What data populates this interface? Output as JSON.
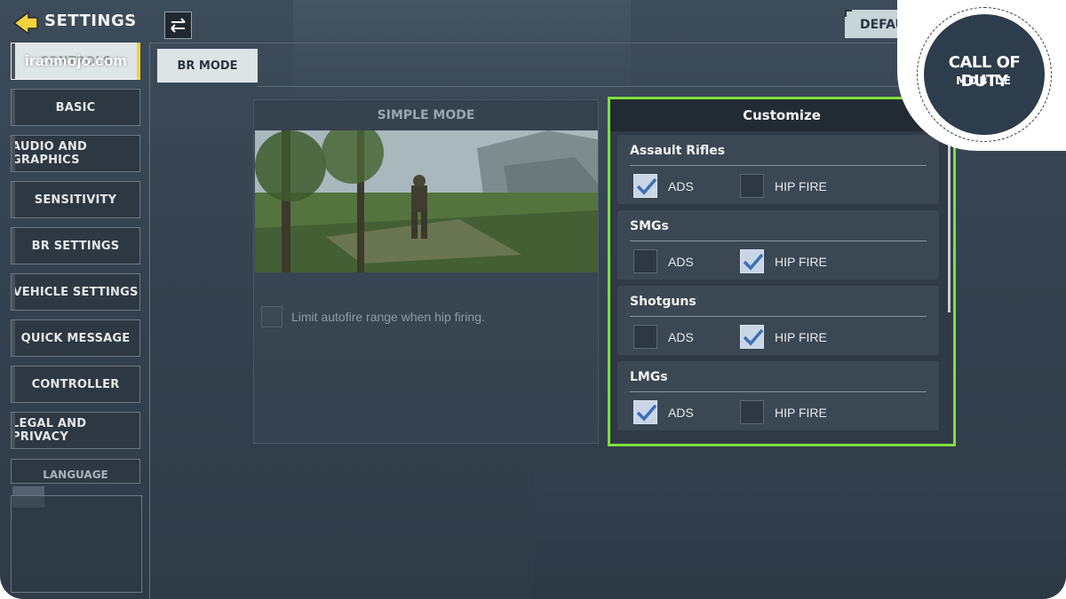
{
  "header": {
    "title": "SETTINGS",
    "default_label": "DEFAULT"
  },
  "watermark": "iranmojo.com",
  "sidebar": {
    "items": [
      {
        "label": "CONTROLS",
        "active": true
      },
      {
        "label": "BASIC"
      },
      {
        "label": "AUDIO AND GRAPHICS"
      },
      {
        "label": "SENSITIVITY"
      },
      {
        "label": "BR SETTINGS"
      },
      {
        "label": "VEHICLE SETTINGS"
      },
      {
        "label": "QUICK MESSAGE"
      },
      {
        "label": "CONTROLLER"
      },
      {
        "label": "LEGAL AND PRIVACY"
      }
    ],
    "partial_item": "LANGUAGE"
  },
  "tabs": {
    "br_mode": "BR MODE"
  },
  "simple_mode": {
    "title": "SIMPLE MODE",
    "limit_autofire_label": "Limit autofire range when hip firing."
  },
  "customize": {
    "title": "Customize",
    "groups": [
      {
        "name": "Assault Rifles",
        "ads_label": "ADS",
        "hip_label": "HIP FIRE",
        "ads_checked": true,
        "hip_checked": false
      },
      {
        "name": "SMGs",
        "ads_label": "ADS",
        "hip_label": "HIP FIRE",
        "ads_checked": false,
        "hip_checked": true
      },
      {
        "name": "Shotguns",
        "ads_label": "ADS",
        "hip_label": "HIP FIRE",
        "ads_checked": false,
        "hip_checked": true
      },
      {
        "name": "LMGs",
        "ads_label": "ADS",
        "hip_label": "HIP FIRE",
        "ads_checked": true,
        "hip_checked": false
      }
    ]
  },
  "logo": {
    "line1": "CALL OF DUTY",
    "line2": "MOBILE"
  },
  "colors": {
    "accent_green": "#7ee03d",
    "accent_yellow": "#f3d33b",
    "check_fill": "#c9d6e6"
  }
}
